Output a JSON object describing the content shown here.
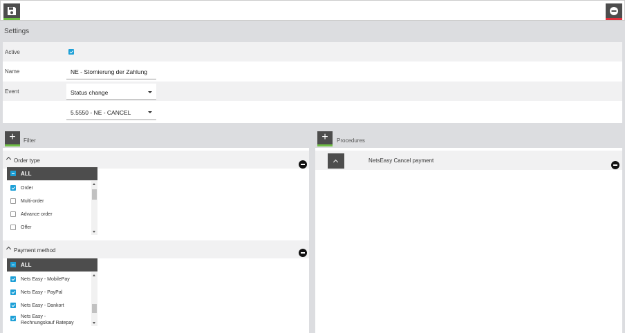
{
  "toolbar": {
    "save_icon": "floppy-disk-icon",
    "remove_icon": "minus-circle-icon"
  },
  "settings": {
    "title": "Settings",
    "active_label": "Active",
    "active_checked": true,
    "name_label": "Name",
    "name_value": "NE - Stornierung der Zahlung",
    "event_label": "Event",
    "event_value": "Status change",
    "status_value": "5.5550 - NE - CANCEL"
  },
  "filter": {
    "title": "Filter",
    "order_type": {
      "title": "Order type",
      "all_label": "ALL",
      "items": [
        {
          "label": "Order",
          "checked": true
        },
        {
          "label": "Multi-order",
          "checked": false
        },
        {
          "label": "Advance order",
          "checked": false
        },
        {
          "label": "Offer",
          "checked": false
        }
      ]
    },
    "payment_method": {
      "title": "Payment method",
      "all_label": "ALL",
      "items": [
        {
          "label": "Nets Easy - MobilePay",
          "checked": true
        },
        {
          "label": "Nets Easy - PayPal",
          "checked": true
        },
        {
          "label": "Nets Easy - Dankort",
          "checked": true
        },
        {
          "label": "Nets Easy - Rechnungskauf Ratepay",
          "line1": "Nets Easy -",
          "line2": "Rechnungskauf Ratepay",
          "checked": true
        }
      ]
    }
  },
  "procedures": {
    "title": "Procedures",
    "items": [
      {
        "label": "NetsEasy Cancel payment"
      }
    ]
  },
  "colors": {
    "accent_blue": "#1ea0d7",
    "green": "#6fbe44",
    "red": "#e0303c",
    "dark": "#4d4d4d"
  }
}
